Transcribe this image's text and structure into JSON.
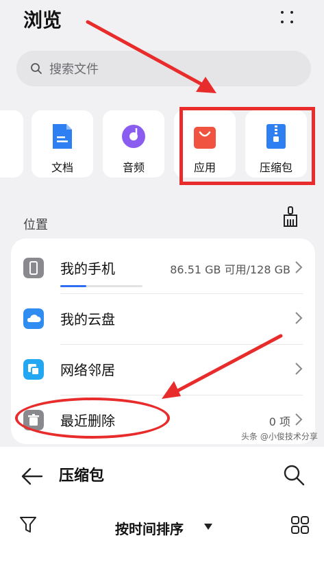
{
  "header": {
    "title": "浏览"
  },
  "search": {
    "placeholder": "搜索文件"
  },
  "categories": [
    {
      "label": "文档",
      "icon": "document-icon"
    },
    {
      "label": "音频",
      "icon": "audio-icon"
    },
    {
      "label": "应用",
      "icon": "app-icon"
    },
    {
      "label": "压缩包",
      "icon": "archive-icon"
    }
  ],
  "location": {
    "title": "位置",
    "items": [
      {
        "name": "我的手机",
        "value": "86.51 GB 可用/128 GB",
        "icon": "phone-icon",
        "storage_used_fraction": 0.32
      },
      {
        "name": "我的云盘",
        "value": "",
        "icon": "cloud-icon"
      },
      {
        "name": "网络邻居",
        "value": "",
        "icon": "network-icon"
      },
      {
        "name": "最近删除",
        "value": "0 项",
        "icon": "trash-icon"
      }
    ]
  },
  "watermark": "头条 @小俊技术分享",
  "bottom": {
    "title": "压缩包",
    "sort_label": "按时间排序"
  },
  "colors": {
    "accent_blue": "#2e6ff2",
    "audio_purple": "#8a5cf0",
    "app_red": "#f0533f",
    "annotation_red": "#e82b2b",
    "cloud_blue": "#2f8cf0",
    "network_blue": "#23a7f2"
  }
}
